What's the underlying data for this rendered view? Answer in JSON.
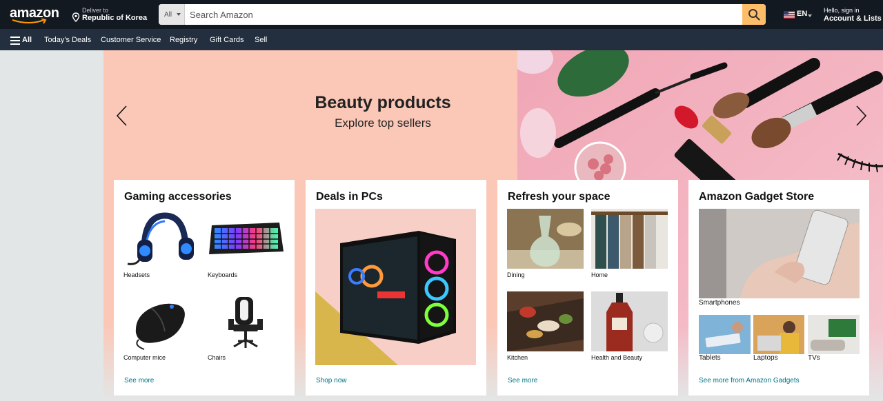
{
  "header": {
    "logo_text": "amazon",
    "deliver_line1": "Deliver to",
    "deliver_line2": "Republic of Korea",
    "search_category": "All",
    "search_placeholder": "Search Amazon",
    "language": "EN",
    "account_line1": "Hello, sign in",
    "account_line2": "Account & Lists"
  },
  "nav": {
    "all_label": "All",
    "links": [
      "Today's Deals",
      "Customer Service",
      "Registry",
      "Gift Cards",
      "Sell"
    ]
  },
  "hero": {
    "title": "Beauty products",
    "subtitle": "Explore top sellers"
  },
  "cards": [
    {
      "title": "Gaming accessories",
      "tiles": [
        {
          "label": "Headsets"
        },
        {
          "label": "Keyboards"
        },
        {
          "label": "Computer mice"
        },
        {
          "label": "Chairs"
        }
      ],
      "link": "See more"
    },
    {
      "title": "Deals in PCs",
      "link": "Shop now"
    },
    {
      "title": "Refresh your space",
      "tiles": [
        {
          "label": "Dining"
        },
        {
          "label": "Home"
        },
        {
          "label": "Kitchen"
        },
        {
          "label": "Health and Beauty"
        }
      ],
      "link": "See more"
    },
    {
      "title": "Amazon Gadget Store",
      "main_label": "Smartphones",
      "tiles": [
        {
          "label": "Tablets"
        },
        {
          "label": "Laptops"
        },
        {
          "label": "TVs"
        }
      ],
      "link": "See more from Amazon Gadgets"
    }
  ],
  "colors": {
    "header_bg": "#131921",
    "subnav_bg": "#232f3e",
    "search_button": "#febd69",
    "link": "#007185",
    "hero_bg": "#fbc8b8"
  }
}
